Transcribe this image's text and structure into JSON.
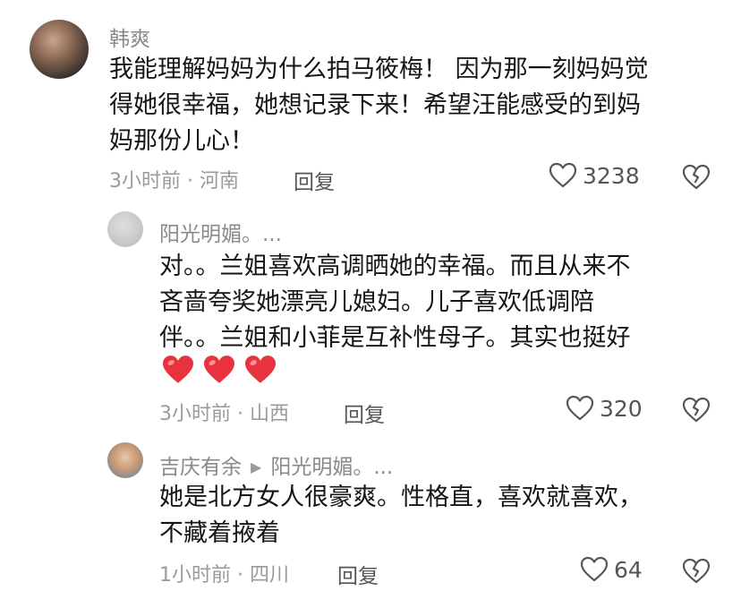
{
  "comments": [
    {
      "author": "韩爽",
      "lines": [
        "我能理解妈妈为什么拍马筱梅！ 因为那一刻妈妈觉",
        "得她很幸福，她想记录下来！希望汪能感受的到妈",
        "妈那份儿心！"
      ],
      "time": "3小时前",
      "location": "河南",
      "reply_label": "回复",
      "likes": "3238"
    },
    {
      "author": "阳光明媚。...",
      "lines": [
        "对。。兰姐喜欢高调晒她的幸福。而且从来不",
        "吝啬夸奖她漂亮儿媳妇。儿子喜欢低调陪",
        "伴。。兰姐和小菲是互补性母子。其实也挺好"
      ],
      "emojis": [
        "❤️",
        "❤️",
        "❤️"
      ],
      "time": "3小时前",
      "location": "山西",
      "reply_label": "回复",
      "likes": "320"
    },
    {
      "author": "吉庆有余",
      "reply_to": "阳光明媚。...",
      "lines": [
        "她是北方女人很豪爽。性格直，喜欢就喜欢，",
        "不藏着掖着"
      ],
      "time": "1小时前",
      "location": "四川",
      "reply_label": "回复",
      "likes": "64"
    }
  ],
  "meta_separator": "·"
}
